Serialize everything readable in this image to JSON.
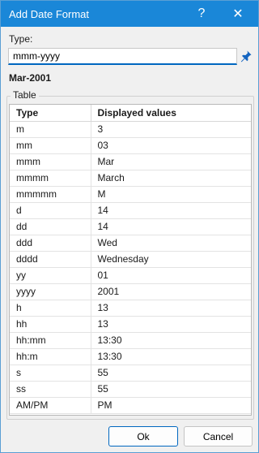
{
  "window": {
    "title": "Add Date Format",
    "help_label": "?",
    "close_label": "✕"
  },
  "form": {
    "type_label": "Type:",
    "type_value": "mmm-yyyy",
    "preview": "Mar-2001"
  },
  "group": {
    "label": "Table"
  },
  "table": {
    "headers": [
      "Type",
      "Displayed values"
    ],
    "rows": [
      [
        "m",
        "3"
      ],
      [
        "mm",
        "03"
      ],
      [
        "mmm",
        "Mar"
      ],
      [
        "mmmm",
        "March"
      ],
      [
        "mmmmm",
        "M"
      ],
      [
        "d",
        "14"
      ],
      [
        "dd",
        "14"
      ],
      [
        "ddd",
        "Wed"
      ],
      [
        "dddd",
        "Wednesday"
      ],
      [
        "yy",
        "01"
      ],
      [
        "yyyy",
        "2001"
      ],
      [
        "h",
        "13"
      ],
      [
        "hh",
        "13"
      ],
      [
        "hh:mm",
        "13:30"
      ],
      [
        "hh:m",
        "13:30"
      ],
      [
        "s",
        "55"
      ],
      [
        "ss",
        "55"
      ],
      [
        "AM/PM",
        "PM"
      ]
    ]
  },
  "buttons": {
    "ok": "Ok",
    "cancel": "Cancel"
  },
  "icons": {
    "pin": "pin-icon",
    "help": "help-icon",
    "close": "close-icon"
  },
  "colors": {
    "titlebar": "#1a87d8",
    "accent": "#0067c0"
  }
}
